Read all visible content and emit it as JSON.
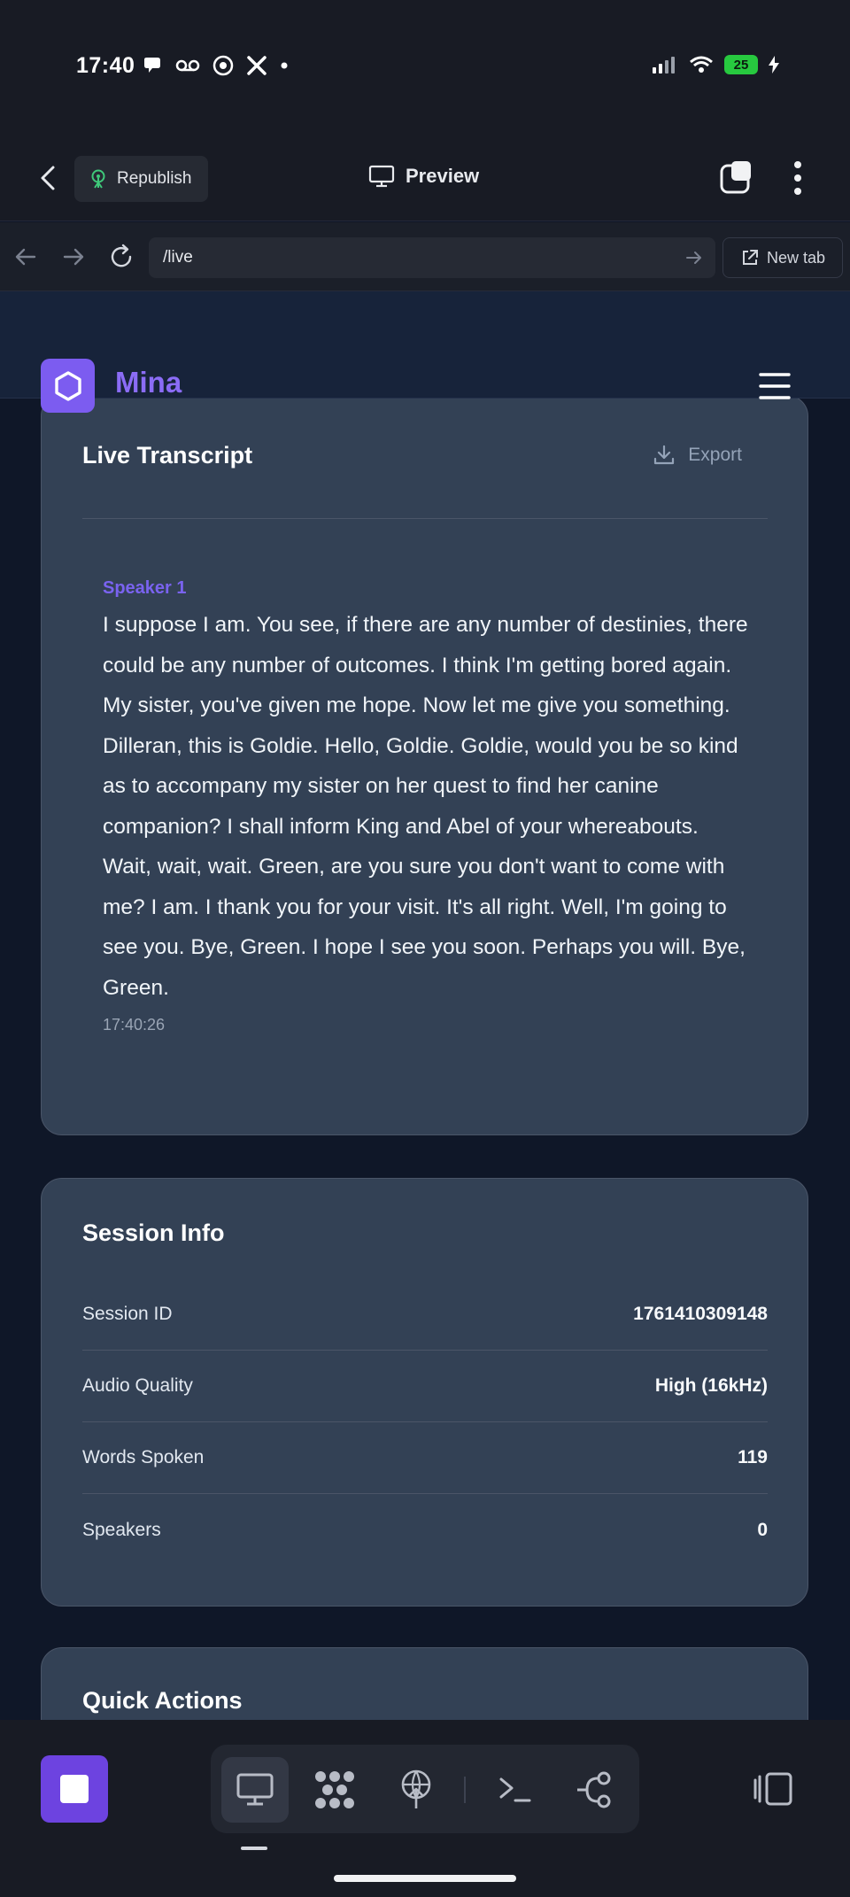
{
  "status_bar": {
    "time": "17:40",
    "left_icons": [
      "bubble-icon",
      "voicemail-icon",
      "ball-icon",
      "x-icon",
      "dot-icon"
    ],
    "right_icons": [
      "signal-icon",
      "wifi-icon"
    ],
    "battery": "25"
  },
  "app_bar": {
    "republish_label": "Republish",
    "preview_label": "Preview"
  },
  "browser": {
    "url": "/live",
    "new_tab_label": "New tab"
  },
  "site": {
    "brand": "Mina"
  },
  "transcript": {
    "title": "Live Transcript",
    "export_label": "Export",
    "speaker": "Speaker 1",
    "text": "I suppose I am. You see, if there are any number of destinies, there could be any number of outcomes. I think I'm getting bored again. My sister, you've given me hope. Now let me give you something. Dilleran, this is Goldie. Hello, Goldie. Goldie, would you be so kind as to accompany my sister on her quest to find her canine companion? I shall inform King and Abel of your whereabouts. Wait, wait, wait. Green, are you sure you don't want to come with me? I am. I thank you for your visit. It's all right. Well, I'm going to see you. Bye, Green. I hope I see you soon. Perhaps you will. Bye, Green.",
    "timestamp": "17:40:26"
  },
  "session_info": {
    "title": "Session Info",
    "rows": [
      {
        "label": "Session ID",
        "value": "1761410309148"
      },
      {
        "label": "Audio Quality",
        "value": "High (16kHz)"
      },
      {
        "label": "Words Spoken",
        "value": "119"
      },
      {
        "label": "Speakers",
        "value": "0"
      }
    ]
  },
  "quick_actions": {
    "title": "Quick Actions"
  },
  "dock": {
    "tools": [
      "desktop-icon",
      "dots-grid-icon",
      "antenna-icon",
      "terminal-icon",
      "branch-icon"
    ],
    "active_tool": "desktop-icon"
  },
  "colors": {
    "accent": "#7c5cf0",
    "card": "#334155",
    "page_bg": "#0f1728",
    "stop_button": "#6d43e0"
  }
}
